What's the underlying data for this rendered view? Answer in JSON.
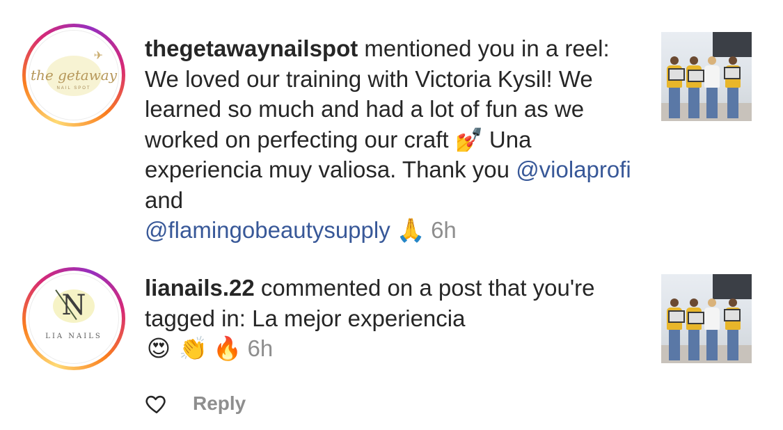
{
  "notifications": [
    {
      "username": "thegetawaynailspot",
      "avatar": {
        "script": "the getaway",
        "sub": "NAIL SPOT",
        "plane": "✈"
      },
      "segments": [
        {
          "type": "text",
          "value": " mentioned you in a reel: We loved our training with Victoria Kysil! We learned so much and had a lot of fun as we worked on perfecting our craft "
        },
        {
          "type": "emoji",
          "value": "💅",
          "name": "nail-polish-emoji"
        },
        {
          "type": "text",
          "value": " Una experiencia muy valiosa. Thank you "
        },
        {
          "type": "mention",
          "value": "@violaprofi"
        },
        {
          "type": "text",
          "value": " and "
        },
        {
          "type": "mention",
          "value": "@flamingobeautysupply"
        },
        {
          "type": "text",
          "value": " "
        },
        {
          "type": "emoji",
          "value": "🙏",
          "name": "folded-hands-emoji"
        }
      ],
      "time": "6h",
      "thumbnail_icon": "group-photo"
    },
    {
      "username": "lianails.22",
      "avatar": {
        "monogram": "N",
        "wordmark": "LIA NAILS"
      },
      "segments": [
        {
          "type": "text",
          "value": " commented on a post that you're tagged in: La mejor experiencia "
        },
        {
          "type": "emoji",
          "value": "😍",
          "name": "heart-eyes-emoji"
        },
        {
          "type": "emoji",
          "value": "👏",
          "name": "clapping-hands-emoji"
        },
        {
          "type": "emoji",
          "value": "🔥",
          "name": "fire-emoji"
        }
      ],
      "time": "6h",
      "thumbnail_icon": "group-photo",
      "actions": {
        "like_icon": "heart-outline-icon",
        "reply_label": "Reply"
      }
    }
  ],
  "colors": {
    "mention": "#385898",
    "muted": "#8e8e8e",
    "text": "#262626"
  }
}
